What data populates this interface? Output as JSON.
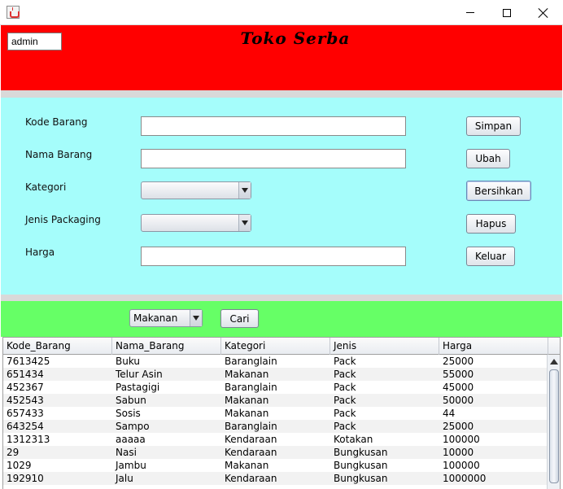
{
  "window": {
    "title": "",
    "controls": {
      "minimize": "minimize-icon",
      "maximize": "maximize-icon",
      "close": "close-icon"
    }
  },
  "header": {
    "user_field": "admin",
    "title": "Toko Serba",
    "background": "#ff0000"
  },
  "form": {
    "background": "#a5fdfb",
    "fields": {
      "kode_label": "Kode Barang",
      "kode_value": "",
      "nama_label": "Nama Barang",
      "nama_value": "",
      "kategori_label": "Kategori",
      "kategori_value": "",
      "jenis_label": "Jenis Packaging",
      "jenis_value": "",
      "harga_label": "Harga",
      "harga_value": ""
    },
    "buttons": {
      "simpan": "Simpan",
      "ubah": "Ubah",
      "bersihkan": "Bersihkan",
      "hapus": "Hapus",
      "keluar": "Keluar"
    }
  },
  "search": {
    "background": "#66ff66",
    "filter_value": "Makanan",
    "cari_label": "Cari"
  },
  "table": {
    "columns": [
      "Kode_Barang",
      "Nama_Barang",
      "Kategori",
      "Jenis",
      "Harga"
    ],
    "rows": [
      [
        "7613425",
        "Buku",
        "Baranglain",
        "Pack",
        "25000"
      ],
      [
        "651434",
        "Telur Asin",
        "Makanan",
        "Pack",
        "55000"
      ],
      [
        "452367",
        "Pastagigi",
        "Baranglain",
        "Pack",
        "45000"
      ],
      [
        "452543",
        "Sabun",
        "Makanan",
        "Pack",
        "50000"
      ],
      [
        "657433",
        "Sosis",
        "Makanan",
        "Pack",
        "44"
      ],
      [
        "643254",
        "Sampo",
        "Baranglain",
        "Pack",
        "25000"
      ],
      [
        "1312313",
        "aaaaa",
        "Kendaraan",
        "Kotakan",
        "100000"
      ],
      [
        "29",
        "Nasi",
        "Kendaraan",
        "Bungkusan",
        "10000"
      ],
      [
        "1029",
        "Jambu",
        "Makanan",
        "Bungkusan",
        "100000"
      ],
      [
        "192910",
        "Jalu",
        "Kendaraan",
        "Bungkusan",
        "1000000"
      ],
      [
        "",
        "",
        "",
        "",
        ""
      ]
    ]
  }
}
